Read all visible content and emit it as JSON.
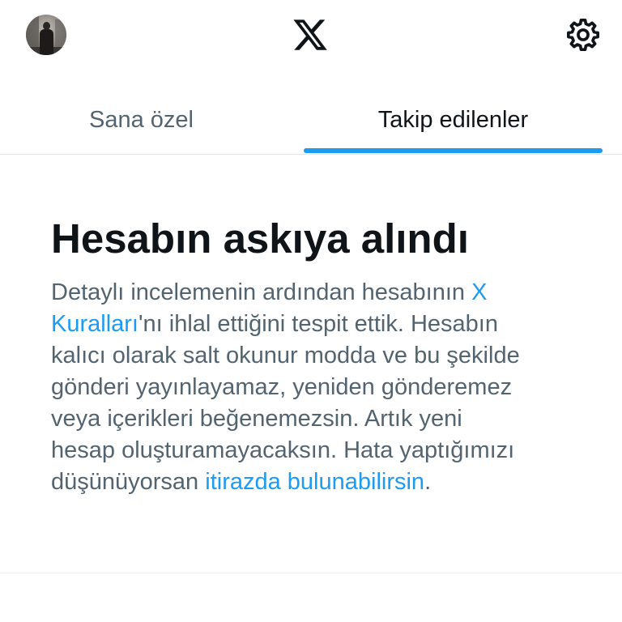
{
  "header": {
    "avatar": "profile-avatar",
    "logo_icon": "x-logo-icon",
    "settings_icon": "gear-icon"
  },
  "tabs": [
    {
      "label": "Sana özel",
      "active": false
    },
    {
      "label": "Takip edilenler",
      "active": true
    }
  ],
  "notice": {
    "title": "Hesabın askıya alındı",
    "body_part1": "Detaylı incelemenin ardından hesabının ",
    "link_rules": "X Kuralları",
    "body_part2": "'nı ihlal ettiğini tespit ettik. Hesabın kalıcı olarak salt okunur modda ve bu şekilde gönderi yayınlayamaz, yeniden gönderemez veya içerikleri beğenemezsin. Artık yeni hesap oluşturamayacaksın. Hata yaptığımızı düşünüyorsan ",
    "link_appeal": "itirazda bulunabilirsin",
    "body_part3": "."
  },
  "colors": {
    "accent": "#1d9bf0",
    "text_primary": "#0f1419",
    "text_secondary": "#536471",
    "divider": "#eff3f4"
  }
}
